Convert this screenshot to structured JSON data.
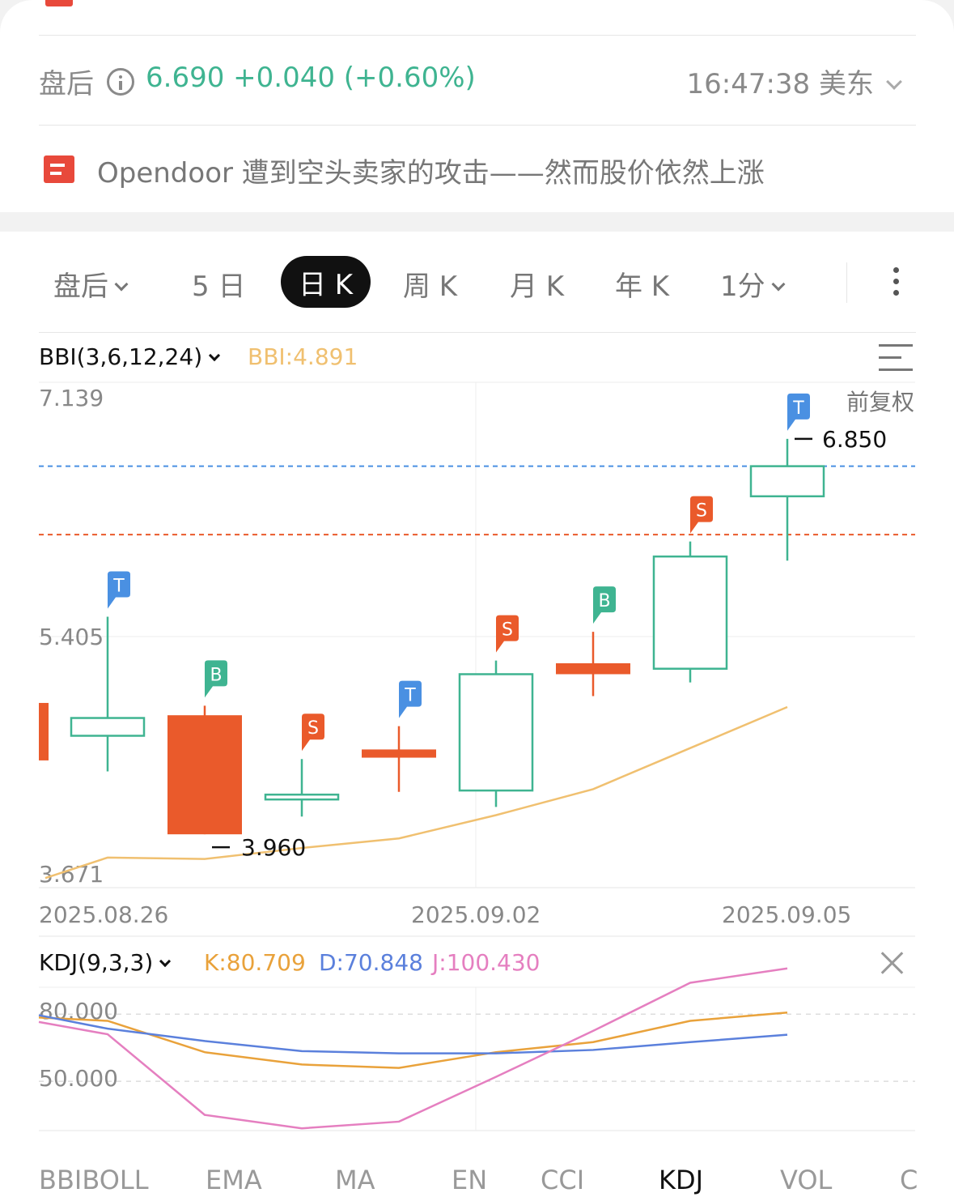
{
  "after_hours": {
    "label": "盘后",
    "price_change": "6.690 +0.040 (+0.60%)",
    "time": "16:47:38 美东"
  },
  "news": {
    "headline": "Opendoor 遭到空头卖家的攻击——然而股价依然上涨"
  },
  "tabs": [
    {
      "label": "盘后",
      "dropdown": true
    },
    {
      "label": "5 日"
    },
    {
      "label": "日 K",
      "active": true
    },
    {
      "label": "周 K"
    },
    {
      "label": "月 K"
    },
    {
      "label": "年 K"
    },
    {
      "label": "1分",
      "dropdown": true
    }
  ],
  "main_indicator": {
    "name": "BBI(3,6,12,24)",
    "value_text": "BBI:4.891"
  },
  "kdj_indicator": {
    "name": "KDJ(9,3,3)",
    "k_text": "K:80.709",
    "d_text": "D:70.848",
    "j_text": "J:100.430"
  },
  "bottom_tabs": [
    "BBIBOLL",
    "EMA",
    "MA",
    "EN",
    "CCI",
    "KDJ",
    "VOL",
    "C"
  ],
  "bottom_tab_active": "KDJ",
  "colors": {
    "up": "#3fb491",
    "down": "#ea5a2b",
    "bbi": "#f0c070",
    "k": "#e9a23b",
    "d": "#5b80dc",
    "j": "#e57fc0",
    "marker_t": "#4a90e2",
    "marker_b": "#3fb491",
    "marker_s": "#ea5a2b"
  },
  "chart_data": [
    {
      "type": "candlestick",
      "y_axis_labels": [
        "7.139",
        "5.405",
        "3.671"
      ],
      "ylim": [
        3.671,
        7.139
      ],
      "x_axis_labels": [
        "2025.08.26",
        "2025.09.02",
        "2025.09.05"
      ],
      "adjust_label": "前复权",
      "high_label": "6.850",
      "low_label": "3.960",
      "reference_lines": [
        {
          "value": 6.65,
          "color": "#4a90e2",
          "style": "dashed"
        },
        {
          "value": 6.15,
          "color": "#ea5a2b",
          "style": "dashed"
        }
      ],
      "candles": [
        {
          "open": 4.92,
          "close": 4.92,
          "high": 4.92,
          "low": 4.5,
          "dir": "down",
          "partial": true
        },
        {
          "open": 4.68,
          "close": 4.81,
          "high": 5.55,
          "low": 4.42,
          "dir": "up",
          "marker": "T"
        },
        {
          "open": 4.83,
          "close": 3.96,
          "high": 4.9,
          "low": 3.96,
          "dir": "down",
          "marker": "B"
        },
        {
          "open": 4.25,
          "close": 4.25,
          "high": 4.51,
          "low": 4.09,
          "dir": "up",
          "marker": "S"
        },
        {
          "open": 4.58,
          "close": 4.52,
          "high": 4.75,
          "low": 4.27,
          "dir": "down",
          "marker": "T"
        },
        {
          "open": 4.28,
          "close": 5.13,
          "high": 5.23,
          "low": 4.16,
          "dir": "up",
          "marker": "S"
        },
        {
          "open": 5.21,
          "close": 5.13,
          "high": 5.44,
          "low": 4.97,
          "dir": "down",
          "marker": "B"
        },
        {
          "open": 5.17,
          "close": 5.99,
          "high": 6.1,
          "low": 5.07,
          "dir": "up",
          "marker": "S"
        },
        {
          "open": 6.65,
          "close": 6.43,
          "high": 6.85,
          "low": 5.96,
          "dir": "up",
          "marker": "T"
        }
      ],
      "series": [
        {
          "name": "BBI",
          "values": [
            3.64,
            3.79,
            3.78,
            3.86,
            3.93,
            4.1,
            4.29,
            4.59,
            4.89
          ]
        }
      ]
    },
    {
      "type": "line",
      "y_axis_labels": [
        "80.000",
        "50.000"
      ],
      "ylim": [
        28,
        92
      ],
      "series": [
        {
          "name": "K",
          "values": [
            78.5,
            77.0,
            63.0,
            57.5,
            56.0,
            63.0,
            67.5,
            77.0,
            80.7
          ]
        },
        {
          "name": "D",
          "values": [
            79.5,
            73.5,
            68.0,
            63.5,
            62.5,
            62.5,
            64.0,
            67.5,
            70.8
          ]
        },
        {
          "name": "J",
          "values": [
            76.5,
            71.0,
            35.0,
            29.0,
            32.0,
            52.0,
            72.5,
            94.0,
            100.4
          ]
        }
      ]
    }
  ]
}
